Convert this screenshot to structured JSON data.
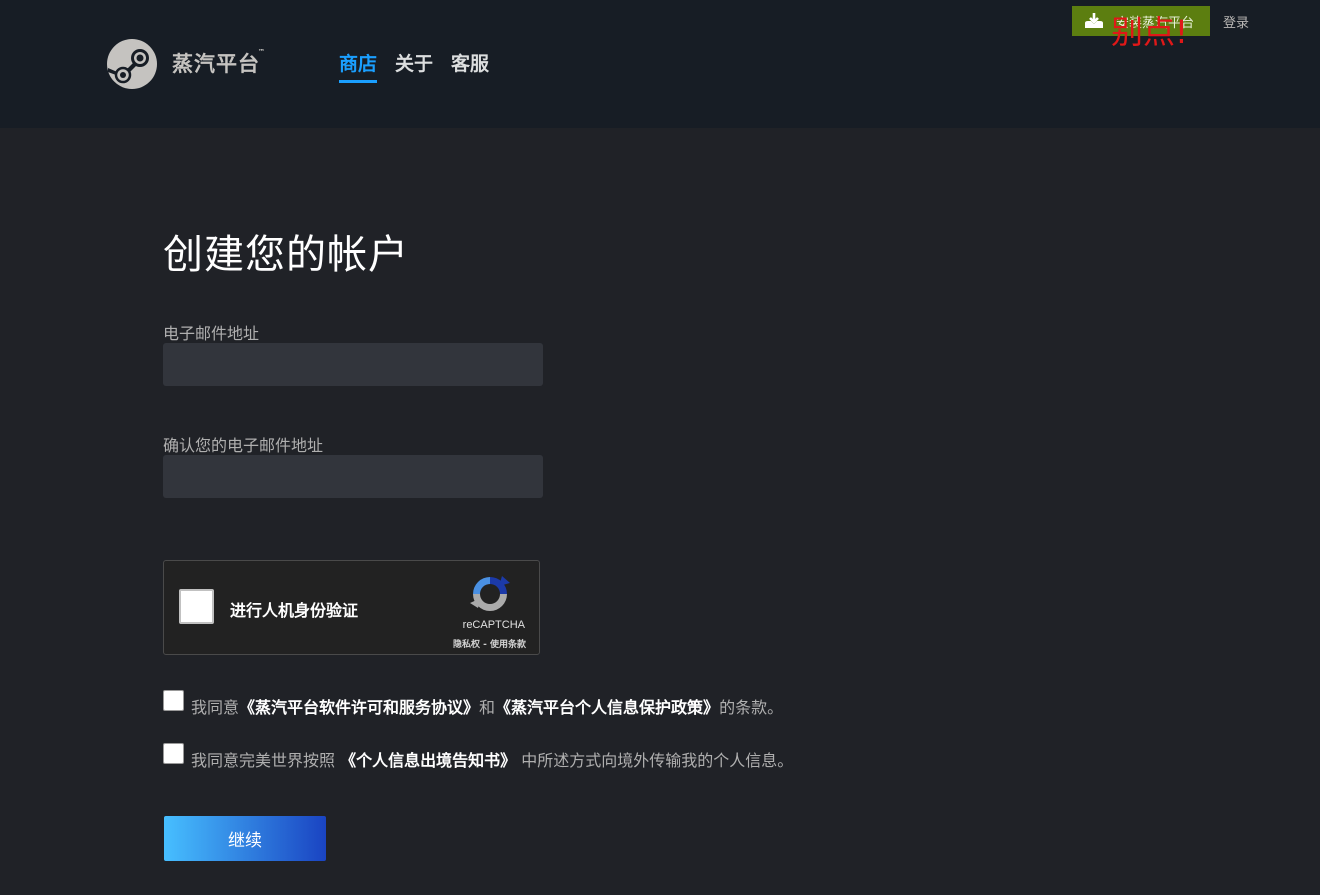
{
  "header": {
    "logo_text": "蒸汽平台",
    "logo_tm": "™",
    "nav": [
      {
        "label": "商店",
        "active": true
      },
      {
        "label": "关于",
        "active": false
      },
      {
        "label": "客服",
        "active": false
      }
    ],
    "install_label": "安装蒸汽平台",
    "login_label": "登录",
    "annotation": "别点!"
  },
  "form": {
    "title": "创建您的帐户",
    "email_label": "电子邮件地址",
    "email_value": "",
    "confirm_email_label": "确认您的电子邮件地址",
    "confirm_email_value": "",
    "captcha": {
      "label": "进行人机身份验证",
      "brand": "reCAPTCHA",
      "links": "隐私权 - 使用条款"
    },
    "agree1": {
      "prefix": "我同意",
      "link1": "《蒸汽平台软件许可和服务协议》",
      "mid": "和",
      "link2": "《蒸汽平台个人信息保护政策》",
      "suffix": "的条款。"
    },
    "agree2": {
      "prefix": "我同意完美世界按照 ",
      "link": "《个人信息出境告知书》",
      "suffix": " 中所述方式向境外传输我的个人信息。"
    },
    "continue_label": "继续"
  },
  "colors": {
    "accent": "#1a9fff",
    "install_green": "#5c7e10",
    "header_bg": "#171d25",
    "page_bg": "#202227"
  }
}
